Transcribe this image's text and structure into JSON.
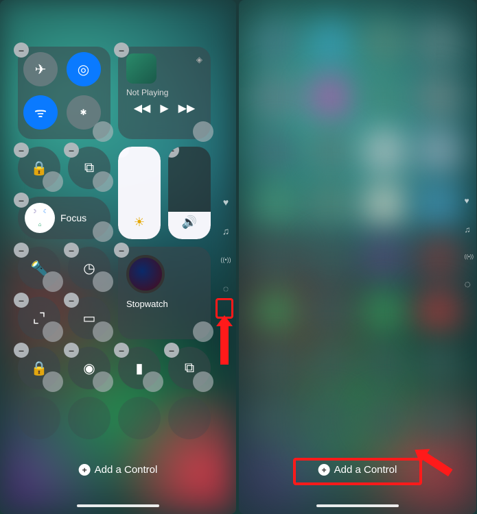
{
  "left": {
    "nowPlaying": {
      "status": "Not Playing",
      "prev": "◀◀",
      "play": "▶",
      "next": "▶▶"
    },
    "focus": {
      "label": "Focus"
    },
    "stopwatch": {
      "label": "Stopwatch"
    },
    "addControl": {
      "label": "Add a Control",
      "plus": "+"
    },
    "removeGlyph": "–",
    "pager": {
      "heart": "♥",
      "music": "♫",
      "radio": "((•))",
      "timer": "◌"
    },
    "icons": {
      "airplane": "✈",
      "airdrop": "◎",
      "wifi": "ᯤ",
      "bluetooth": "✱",
      "airplay": "◈",
      "rotationLock": "🔒",
      "screenMirror": "⧉",
      "brightness": "☀",
      "volume": "🔊",
      "flashlight": "🔦",
      "timer": "◷",
      "scan": "⌞⌝",
      "battery": "▭",
      "lock": "🔒",
      "record": "◉",
      "remote": "▮",
      "mirror2": "⧉"
    }
  },
  "right": {
    "addControl": {
      "label": "Add a Control",
      "plus": "+"
    },
    "pager": {
      "heart": "♥",
      "music": "♫",
      "radio": "((•))",
      "timer": "◌"
    }
  }
}
